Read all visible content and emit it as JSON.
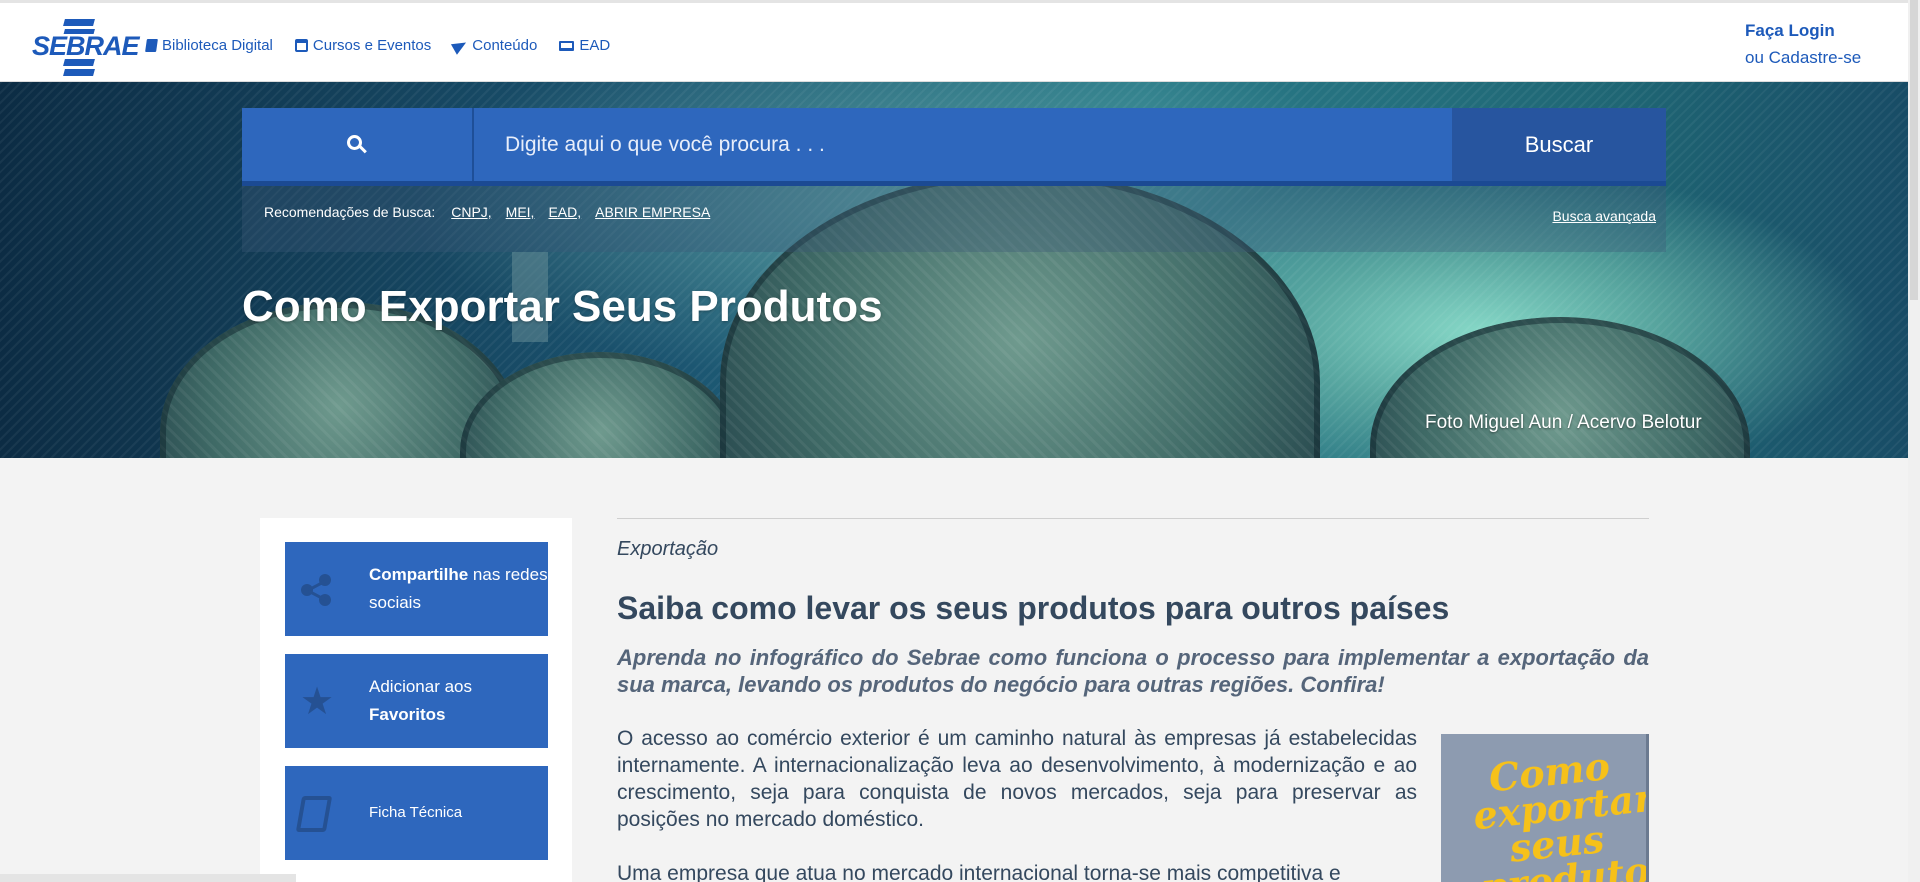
{
  "header": {
    "logo_text": "SEBRAE",
    "nav": [
      {
        "label": "Biblioteca Digital",
        "icon": "book-icon"
      },
      {
        "label": "Cursos e Eventos",
        "icon": "calendar-icon"
      },
      {
        "label": "Conteúdo",
        "icon": "paper-plane-icon"
      },
      {
        "label": "EAD",
        "icon": "laptop-icon"
      }
    ],
    "login_line1": "Faça Login",
    "login_line2": "ou Cadastre-se"
  },
  "search": {
    "placeholder": "Digite aqui o que você procura . . .",
    "button_label": "Buscar",
    "recommendations_label": "Recomendações de Busca:",
    "recommendations": [
      "CNPJ,",
      "MEI,",
      "EAD,",
      "ABRIR EMPRESA"
    ],
    "advanced_label": "Busca avançada"
  },
  "hero": {
    "title": "Como Exportar Seus Produtos",
    "photo_credit": "Foto Miguel Aun / Acervo Belotur"
  },
  "sidebar": {
    "share_bold": "Compartilhe",
    "share_rest": " nas redes sociais",
    "favorites_line1": "Adicionar aos",
    "favorites_bold": "Favoritos",
    "tech_sheet": "Ficha Técnica"
  },
  "article": {
    "category": "Exportação",
    "title": "Saiba como levar os seus produtos para outros países",
    "lead": "Aprenda no infográfico do Sebrae como funciona o processo para implementar a exportação da sua marca, levando os produtos do negócio para outras regiões. Confira!",
    "paragraph1": "O acesso ao comércio exterior é um caminho natural às empresas já estabelecidas internamente. A internacionalização leva ao desenvolvimento, à modernização e ao crescimento, seja para conquista de novos mercados, seja para preservar as posições no mercado doméstico.",
    "paragraph2": "Uma empresa que atua no mercado internacional torna-se mais competitiva e",
    "image_text": "Como exportar seus produtos"
  },
  "colors": {
    "brand_blue": "#1d5aba",
    "button_blue": "#2e67bd",
    "text_dark": "#34485e"
  }
}
